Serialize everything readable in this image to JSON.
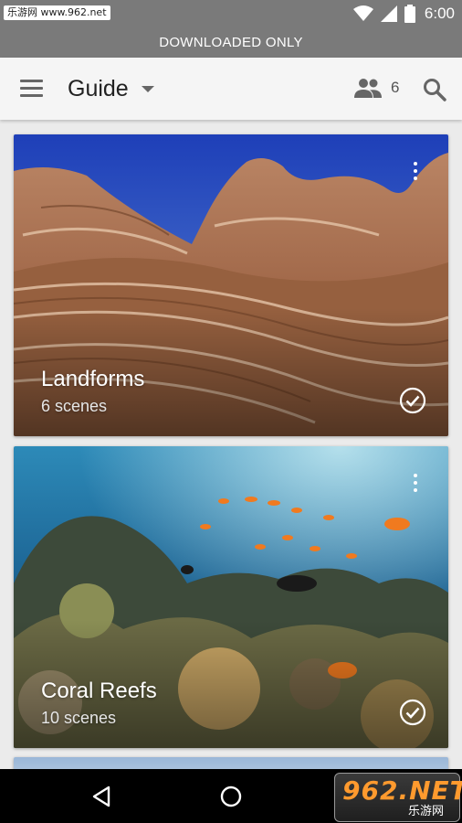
{
  "status_bar": {
    "watermark": "乐游网 www.962.net",
    "time": "6:00",
    "icons": [
      "wifi-icon",
      "signal-icon",
      "battery-icon"
    ]
  },
  "banner": {
    "text": "DOWNLOADED ONLY"
  },
  "app_bar": {
    "title": "Guide",
    "people_count": "6",
    "icons": [
      "menu-icon",
      "dropdown-arrow-icon",
      "people-icon",
      "search-icon"
    ]
  },
  "cards": [
    {
      "title": "Landforms",
      "subtitle": "6 scenes",
      "downloaded": true
    },
    {
      "title": "Coral Reefs",
      "subtitle": "10 scenes",
      "downloaded": true
    }
  ],
  "nav_bar": {
    "icons": [
      "back-icon",
      "home-icon"
    ]
  },
  "watermark_br": {
    "big": "962.NET",
    "small": "乐游网"
  },
  "colors": {
    "status_bar": "#7a7a7a",
    "app_bar": "#f5f5f5",
    "background": "#ebebeb"
  }
}
